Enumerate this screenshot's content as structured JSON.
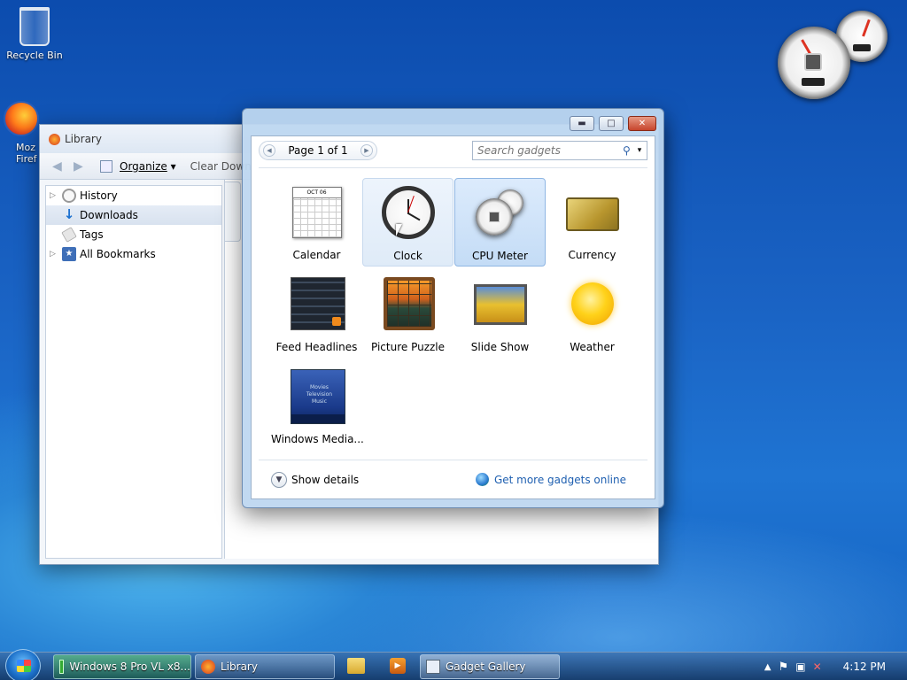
{
  "desktop": {
    "icons": [
      {
        "label": "Recycle Bin",
        "icon": "recycle-bin-icon"
      },
      {
        "label": "Moz\nFiref",
        "icon": "firefox-icon"
      }
    ]
  },
  "library": {
    "title": "Library",
    "toolbar": {
      "organize": "Organize",
      "clear": "Clear Downlo"
    },
    "sidebar": [
      {
        "label": "History",
        "icon": "history-clock-icon",
        "expander": true,
        "selected": false
      },
      {
        "label": "Downloads",
        "icon": "downloads-arrow-icon",
        "expander": false,
        "selected": true
      },
      {
        "label": "Tags",
        "icon": "tag-icon",
        "expander": false,
        "selected": false
      },
      {
        "label": "All Bookmarks",
        "icon": "bookmarks-star-icon",
        "expander": true,
        "selected": false
      }
    ]
  },
  "gallery": {
    "title": "Gadget Gallery",
    "page_indicator": "Page 1 of 1",
    "search_placeholder": "Search gadgets",
    "gadgets": [
      {
        "label": "Calendar",
        "icon": "calendar-gadget-icon",
        "month": "OCT 06"
      },
      {
        "label": "Clock",
        "icon": "clock-gadget-icon"
      },
      {
        "label": "CPU Meter",
        "icon": "cpu-meter-gadget-icon"
      },
      {
        "label": "Currency",
        "icon": "currency-gadget-icon"
      },
      {
        "label": "Feed Headlines",
        "icon": "feed-headlines-gadget-icon"
      },
      {
        "label": "Picture Puzzle",
        "icon": "picture-puzzle-gadget-icon"
      },
      {
        "label": "Slide Show",
        "icon": "slide-show-gadget-icon"
      },
      {
        "label": "Weather",
        "icon": "weather-gadget-icon"
      },
      {
        "label": "Windows Media...",
        "icon": "windows-media-center-gadget-icon",
        "lines": [
          "Movies",
          "Television",
          "Music"
        ]
      }
    ],
    "show_details": "Show details",
    "get_more": "Get more gadgets online"
  },
  "taskbar": {
    "buttons": [
      {
        "label": "Windows 8 Pro VL x8...",
        "icon": "virtualbox-icon"
      },
      {
        "label": "Library",
        "icon": "firefox-icon"
      },
      {
        "label": "Gadget Gallery",
        "icon": "gadget-gallery-icon"
      }
    ],
    "pinned": [
      "folder-icon",
      "media-player-icon"
    ],
    "clock": "4:12 PM"
  },
  "colors": {
    "accent": "#1e5fb0",
    "selection": "#c4dcf6"
  }
}
